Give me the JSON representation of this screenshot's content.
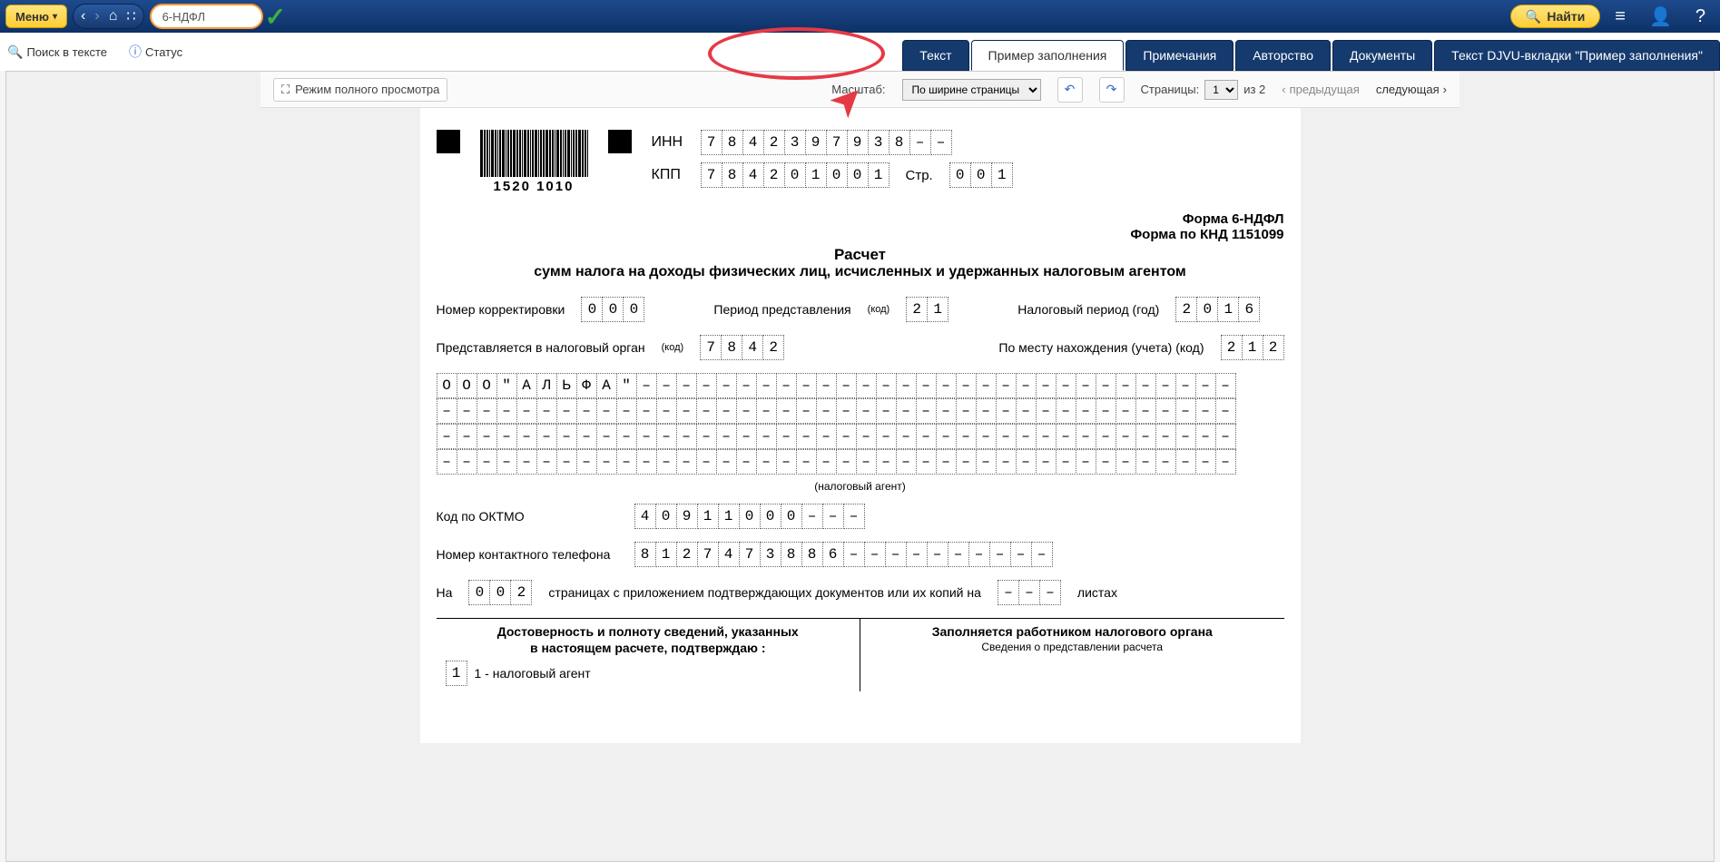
{
  "topbar": {
    "menu_label": "Меню",
    "search_value": "6-НДФЛ",
    "find_label": "Найти"
  },
  "secbar": {
    "search_text_label": "Поиск в тексте",
    "status_label": "Статус"
  },
  "tabs": {
    "text": "Текст",
    "example": "Пример заполнения",
    "notes": "Примечания",
    "authorship": "Авторство",
    "documents": "Документы",
    "djvu": "Текст DJVU-вкладки \"Пример заполнения\""
  },
  "viewer": {
    "fullview_label": "Режим полного просмотра",
    "scale_label": "Масштаб:",
    "scale_value": "По ширине страницы",
    "pages_label": "Страницы:",
    "page_current": "1",
    "page_of": "из 2",
    "prev_label": "предыдущая",
    "next_label": "следующая"
  },
  "doc": {
    "barcode_number": "1520 1010",
    "inn_label": "ИНН",
    "inn": [
      "7",
      "8",
      "4",
      "2",
      "3",
      "9",
      "7",
      "9",
      "3",
      "8",
      "–",
      "–"
    ],
    "kpp_label": "КПП",
    "kpp": [
      "7",
      "8",
      "4",
      "2",
      "0",
      "1",
      "0",
      "0",
      "1"
    ],
    "page_str_label": "Стр.",
    "page_str": [
      "0",
      "0",
      "1"
    ],
    "form_name": "Форма 6-НДФЛ",
    "form_knd": "Форма по КНД 1151099",
    "title1": "Расчет",
    "title2": "сумм налога на доходы физических лиц, исчисленных и удержанных налоговым агентом",
    "correction_label": "Номер корректировки",
    "correction": [
      "0",
      "0",
      "0"
    ],
    "period_label": "Период представления",
    "period_code": "(код)",
    "period": [
      "2",
      "1"
    ],
    "taxyear_label": "Налоговый период (год)",
    "taxyear": [
      "2",
      "0",
      "1",
      "6"
    ],
    "organ_label": "Представляется в налоговый орган",
    "organ": [
      "7",
      "8",
      "4",
      "2"
    ],
    "location_label": "По месту нахождения (учета) (код)",
    "location": [
      "2",
      "1",
      "2"
    ],
    "company_name_chars": [
      "О",
      "О",
      "О",
      "\"",
      "А",
      "Л",
      "Ь",
      "Ф",
      "А",
      "\"",
      "–",
      "–",
      "–",
      "–",
      "–",
      "–",
      "–",
      "–",
      "–",
      "–",
      "–",
      "–",
      "–",
      "–",
      "–",
      "–",
      "–",
      "–",
      "–",
      "–",
      "–",
      "–",
      "–",
      "–",
      "–",
      "–",
      "–",
      "–",
      "–",
      "–"
    ],
    "blank_dash": "–",
    "agent_note": "(налоговый агент)",
    "oktmo_label": "Код по ОКТМО",
    "oktmo": [
      "4",
      "0",
      "9",
      "1",
      "1",
      "0",
      "0",
      "0",
      "–",
      "–",
      "–"
    ],
    "phone_label": "Номер контактного телефона",
    "phone": [
      "8",
      "1",
      "2",
      "7",
      "4",
      "7",
      "3",
      "8",
      "8",
      "6",
      "–",
      "–",
      "–",
      "–",
      "–",
      "–",
      "–",
      "–",
      "–",
      "–"
    ],
    "na_label": "На",
    "pages_count": [
      "0",
      "0",
      "2"
    ],
    "pages_mid": "страницах с приложением подтверждающих документов или их копий на",
    "sheets": [
      "–",
      "–",
      "–"
    ],
    "sheets_label": "листах",
    "sign_left_head": "Достоверность и полноту сведений, указанных",
    "sign_left_sub": "в настоящем расчете, подтверждаю :",
    "sign_agent_code": [
      "1"
    ],
    "sign_agent_text": "1 - налоговый агент",
    "sign_right_head": "Заполняется работником налогового органа",
    "sign_right_sub": "Сведения о представлении расчета"
  }
}
